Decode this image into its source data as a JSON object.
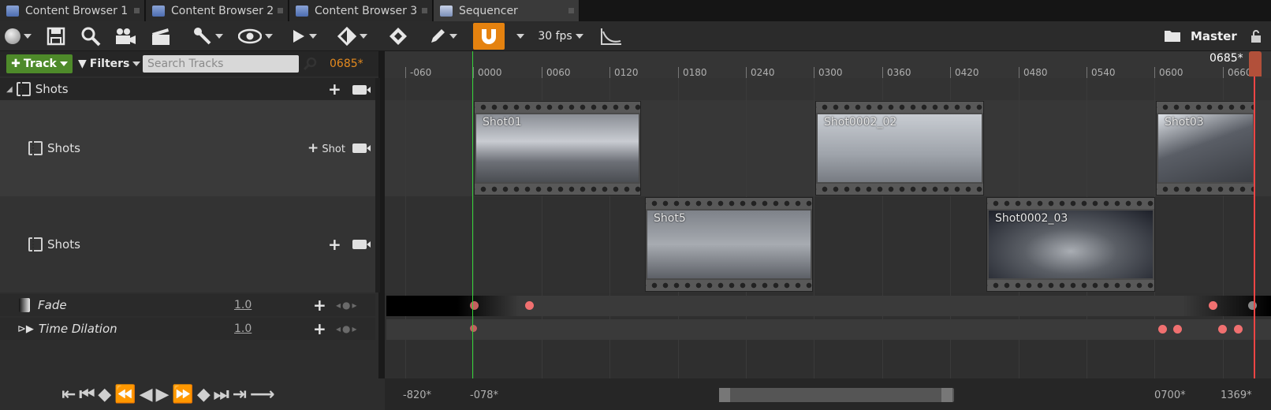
{
  "tabs": [
    {
      "label": "Content Browser 1",
      "active": false
    },
    {
      "label": "Content Browser 2",
      "active": false
    },
    {
      "label": "Content Browser 3",
      "active": false
    },
    {
      "label": "Sequencer",
      "active": true
    }
  ],
  "toolbar": {
    "fps": "30 fps",
    "sequence_name": "Master",
    "icons": [
      "world-icon",
      "save-icon",
      "search-icon",
      "camera-icon",
      "clapper-icon",
      "wrench-icon",
      "eye-icon",
      "play-icon",
      "keyframe-icon",
      "key-tag-icon",
      "pencil-icon",
      "magnet-icon",
      "curve-icon",
      "folder-icon",
      "lock-icon"
    ]
  },
  "track_panel": {
    "add_track": "Track",
    "filters": "Filters",
    "search_placeholder": "Search Tracks",
    "current_frame": "0685*",
    "rows": [
      {
        "label": "Shots",
        "type": "folder"
      },
      {
        "label": "Shots",
        "type": "subtrack",
        "action": "Shot"
      },
      {
        "label": "Shots",
        "type": "subtrack"
      },
      {
        "label": "Fade",
        "value": "1.0"
      },
      {
        "label": "Time Dilation",
        "value": "1.0"
      }
    ]
  },
  "ruler": {
    "playhead_label": "0685*",
    "ticks": [
      "-060",
      "0000",
      "0060",
      "0120",
      "0180",
      "0240",
      "0300",
      "0360",
      "0420",
      "0480",
      "0540",
      "0600",
      "0660"
    ]
  },
  "clips": [
    {
      "label": "Shot01"
    },
    {
      "label": "Shot0002_02"
    },
    {
      "label": "Shot03"
    },
    {
      "label": "Shot5"
    },
    {
      "label": "Shot0002_03"
    }
  ],
  "bottom": {
    "view_start": "-820*",
    "work_start": "-078*",
    "work_end": "0700*",
    "view_end": "1369*"
  },
  "colors": {
    "accent": "#e5820f",
    "track_green": "#4e8a2a",
    "playhead": "#e44444",
    "key": "#f07070"
  }
}
